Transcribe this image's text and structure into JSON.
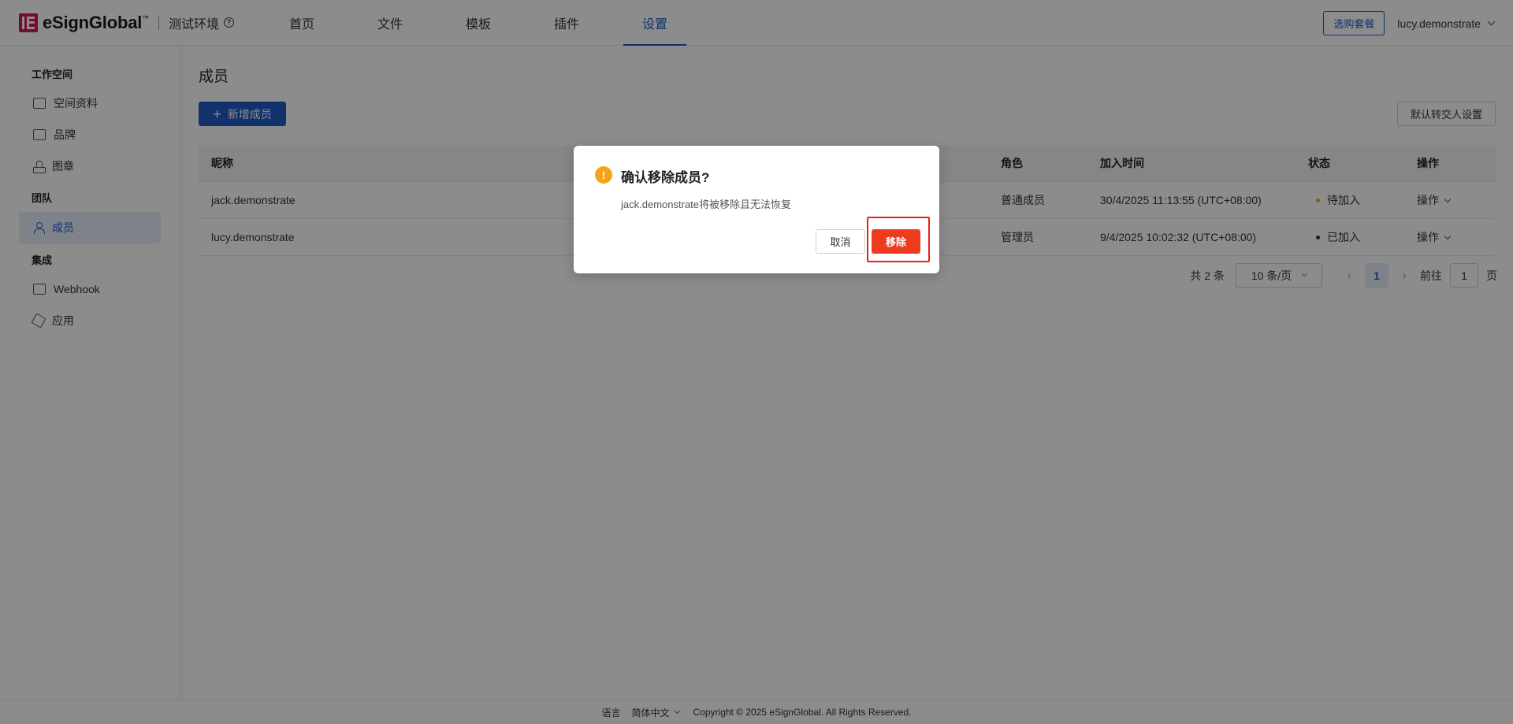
{
  "header": {
    "logo_text": "eSignGlobal",
    "logo_tm": "™",
    "env_label": "测试环境",
    "nav": [
      {
        "label": "首页",
        "active": false
      },
      {
        "label": "文件",
        "active": false
      },
      {
        "label": "模板",
        "active": false
      },
      {
        "label": "插件",
        "active": false
      },
      {
        "label": "设置",
        "active": true
      }
    ],
    "plan_button": "选购套餐",
    "user": "lucy.demonstrate"
  },
  "sidebar": {
    "groups": [
      {
        "title": "工作空间",
        "items": [
          {
            "label": "空间资料",
            "icon": "id-card-icon"
          },
          {
            "label": "品牌",
            "icon": "image-icon"
          },
          {
            "label": "图章",
            "icon": "stamp-icon"
          }
        ]
      },
      {
        "title": "团队",
        "items": [
          {
            "label": "成员",
            "icon": "user-icon",
            "active": true
          }
        ]
      },
      {
        "title": "集成",
        "items": [
          {
            "label": "Webhook",
            "icon": "browser-window-icon"
          },
          {
            "label": "应用",
            "icon": "cube-icon"
          }
        ]
      }
    ]
  },
  "main": {
    "title": "成员",
    "add_button": "新增成员",
    "transfer_button": "默认转交人设置",
    "table": {
      "headers": {
        "nickname": "昵称",
        "role": "角色",
        "joined": "加入时间",
        "status": "状态",
        "actions": "操作"
      },
      "rows": [
        {
          "nickname": "jack.demonstrate",
          "role": "普通成员",
          "joined": "30/4/2025 11:13:55 (UTC+08:00)",
          "status": "待加入",
          "status_color": "#f7a31a",
          "action": "操作"
        },
        {
          "nickname": "lucy.demonstrate",
          "role": "管理员",
          "joined": "9/4/2025 10:02:32 (UTC+08:00)",
          "status": "已加入",
          "status_color": "#333333",
          "action": "操作"
        }
      ]
    },
    "pagination": {
      "total": "共 2 条",
      "page_size": "10 条/页",
      "current_page": "1",
      "goto_label": "前往",
      "goto_value": "1",
      "page_suffix": "页"
    }
  },
  "footer": {
    "language_label": "语言",
    "language_value": "简体中文",
    "copyright": "Copyright © 2025 eSignGlobal. All Rights Reserved."
  },
  "modal": {
    "title": "确认移除成员?",
    "body": "jack.demonstrate将被移除且无法恢复",
    "cancel": "取消",
    "confirm": "移除"
  },
  "colors": {
    "primary": "#1f5bc6",
    "danger": "#ee3b1e",
    "warning": "#f7a31a",
    "brand": "#d4145a"
  }
}
